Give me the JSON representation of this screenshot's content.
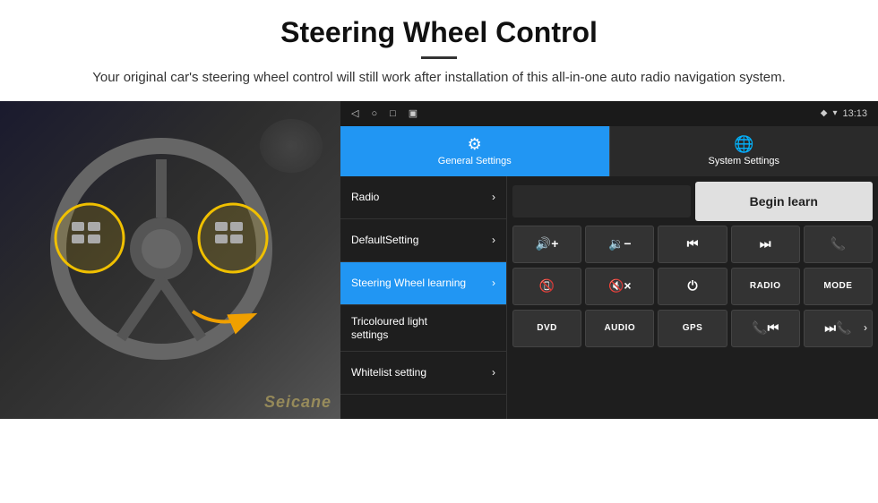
{
  "header": {
    "title": "Steering Wheel Control",
    "subtitle": "Your original car's steering wheel control will still work after installation of this all-in-one auto radio navigation system."
  },
  "statusBar": {
    "navIcon": "◁",
    "homeIcon": "○",
    "recentIcon": "□",
    "screenIcon": "▣",
    "locationIcon": "♦",
    "wifiIcon": "▾",
    "time": "13:13"
  },
  "tabs": [
    {
      "label": "General Settings",
      "icon": "⚙",
      "active": true
    },
    {
      "label": "System Settings",
      "icon": "⚙",
      "active": false
    }
  ],
  "menu": [
    {
      "label": "Radio",
      "active": false,
      "multiline": false
    },
    {
      "label": "DefaultSetting",
      "active": false,
      "multiline": false
    },
    {
      "label": "Steering Wheel learning",
      "active": true,
      "multiline": false
    },
    {
      "label": "Tricoloured light settings",
      "active": false,
      "multiline": true
    },
    {
      "label": "Whitelist setting",
      "active": false,
      "multiline": false
    }
  ],
  "controls": {
    "beginLearnLabel": "Begin learn",
    "buttons": [
      [
        "vol_up",
        "vol_down",
        "prev_track",
        "next_track",
        "phone_pick"
      ],
      [
        "phone_hang",
        "mute",
        "power",
        "RADIO",
        "MODE"
      ],
      [
        "DVD",
        "AUDIO",
        "GPS",
        "media_prev",
        "media_next"
      ]
    ],
    "buttonLabels": {
      "vol_up": "🔊+",
      "vol_down": "🔉-",
      "prev_track": "⏮",
      "next_track": "⏭",
      "phone_pick": "📞",
      "phone_hang": "📞",
      "mute": "🔇x",
      "power": "⏻",
      "RADIO": "RADIO",
      "MODE": "MODE",
      "DVD": "DVD",
      "AUDIO": "AUDIO",
      "GPS": "GPS",
      "media_prev": "📞⏮",
      "media_next": "⏭"
    }
  }
}
